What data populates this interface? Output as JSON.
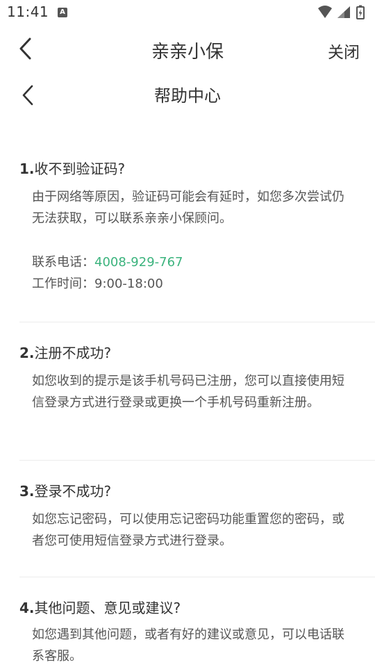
{
  "status_bar": {
    "time": "11:41",
    "notification_icon": "A"
  },
  "app_bar": {
    "title": "亲亲小保",
    "close_label": "关闭"
  },
  "page_header": {
    "title": "帮助中心"
  },
  "faqs": [
    {
      "num": "1.",
      "question": "收不到验证码?",
      "answer": "由于网络等原因，验证码可能会有延时，如您多次尝试仍无法获取，可以联系亲亲小保顾问。"
    },
    {
      "num": "2.",
      "question": "注册不成功?",
      "answer": "如您收到的提示是该手机号码已注册，您可以直接使用短信登录方式进行登录或更换一个手机号码重新注册。"
    },
    {
      "num": "3.",
      "question": "登录不成功?",
      "answer": "如您忘记密码，可以使用忘记密码功能重置您的密码，或者您可使用短信登录方式进行登录。"
    },
    {
      "num": "4.",
      "question": "其他问题、意见或建议?",
      "answer": "如您遇到其他问题，或者有好的建议或意见，可以电话联系客服。"
    }
  ],
  "contact": {
    "phone_label": "联系电话：",
    "phone": "4008-929-767",
    "hours_label": "工作时间：",
    "hours": "9:00-18:00"
  },
  "colors": {
    "accent": "#3bb37d",
    "text": "#333333",
    "secondary_text": "#555555",
    "divider": "#ececec"
  }
}
